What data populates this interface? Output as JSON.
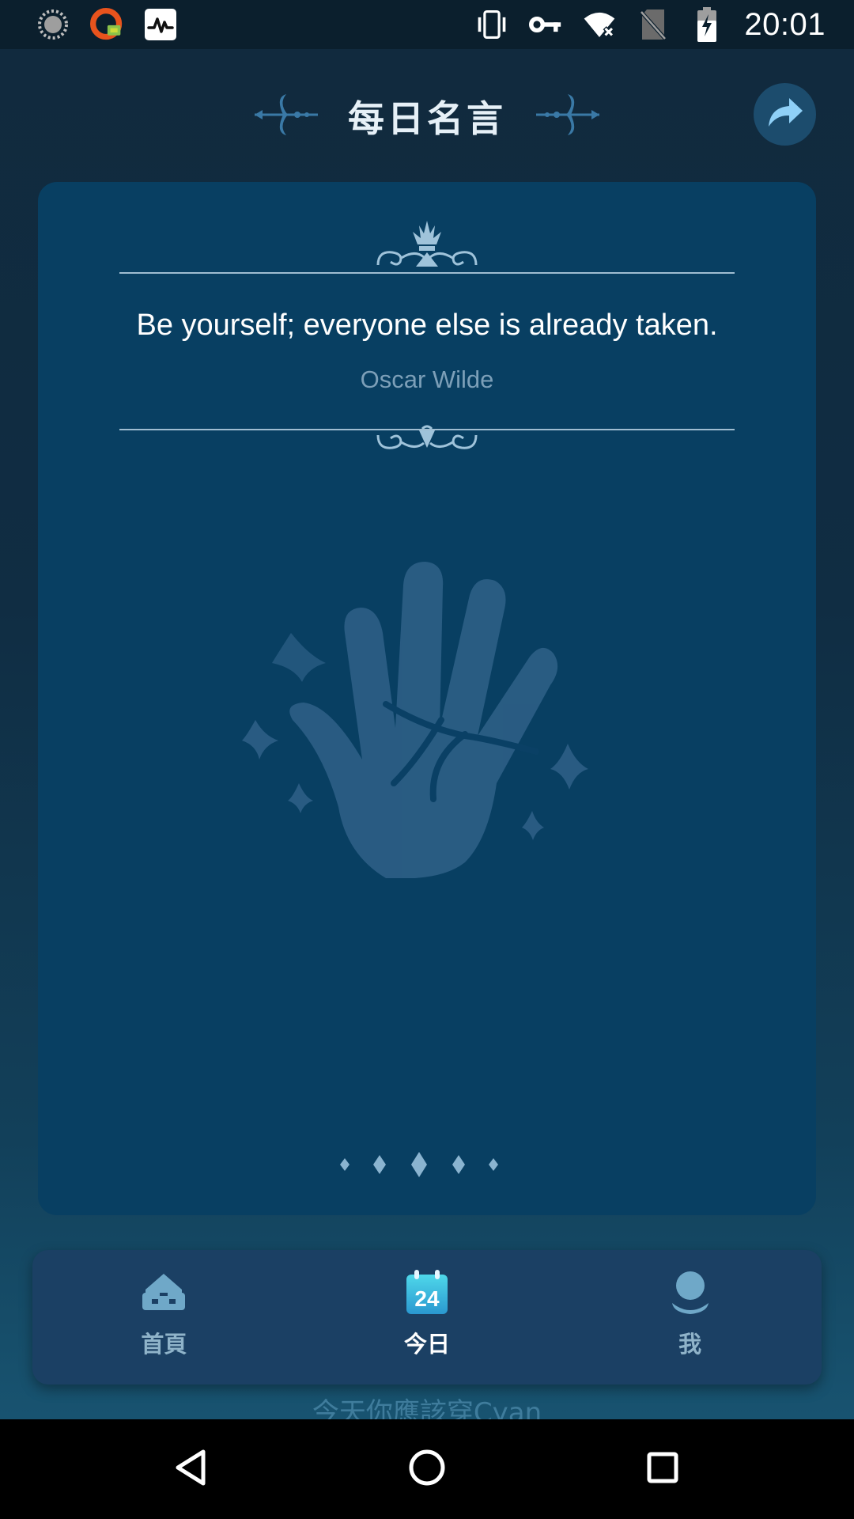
{
  "status_bar": {
    "time": "20:01",
    "left_icons": [
      "loading-circle-icon",
      "vpn-app-icon",
      "activity-monitor-icon"
    ],
    "right_icons": [
      "vibrate-icon",
      "vpn-key-icon",
      "wifi-icon",
      "no-sim-icon",
      "battery-charging-icon"
    ]
  },
  "header": {
    "title": "每日名言",
    "share_icon": "share-arrow-icon"
  },
  "quote_card": {
    "quote": "Be yourself; everyone else is already taken.",
    "author": "Oscar Wilde",
    "illustration": "palm-hand-icon",
    "page_indicator_count": 5
  },
  "bottom_nav": {
    "items": [
      {
        "label": "首頁",
        "icon": "home-icon",
        "active": false
      },
      {
        "label": "今日",
        "icon": "calendar-24-icon",
        "badge": "24",
        "active": true
      },
      {
        "label": "我",
        "icon": "profile-icon",
        "active": false
      }
    ]
  },
  "peek_text": "今天你應該穿Cyan",
  "colors": {
    "background": "#112a3d",
    "card": "#083f62",
    "nav_bar": "#1b4064",
    "accent": "#5aa9d6",
    "muted_text": "#7c9fb8"
  }
}
